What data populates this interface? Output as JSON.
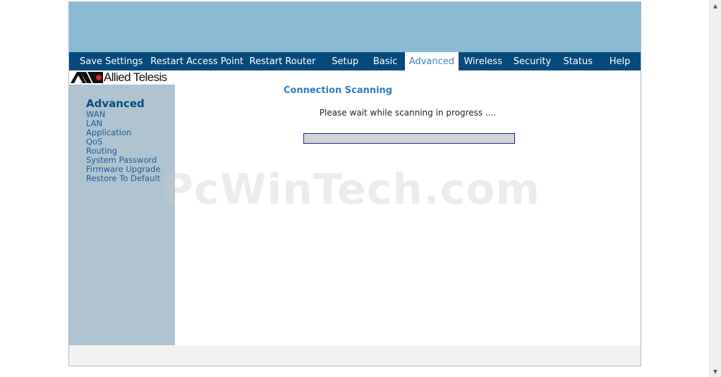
{
  "nav": {
    "items": [
      {
        "label": "Save Settings",
        "active": false
      },
      {
        "label": "Restart Access Point",
        "active": false
      },
      {
        "label": "Restart Router",
        "active": false
      },
      {
        "label": "Setup",
        "active": false
      },
      {
        "label": "Basic",
        "active": false
      },
      {
        "label": "Advanced",
        "active": true
      },
      {
        "label": "Wireless",
        "active": false
      },
      {
        "label": "Security",
        "active": false
      },
      {
        "label": "Status",
        "active": false
      },
      {
        "label": "Help",
        "active": false
      }
    ]
  },
  "logo": {
    "text": "Allied Telesis"
  },
  "sidebar": {
    "title": "Advanced",
    "items": [
      "WAN",
      "LAN",
      "Application",
      "QoS",
      "Routing",
      "System Password",
      "Firmware Upgrade",
      "Restore To Default"
    ]
  },
  "content": {
    "title": "Connection Scanning",
    "message": "Please wait while scanning in progress ....",
    "progress_percent": 0
  },
  "watermark": {
    "text": "PcWinTech.com"
  },
  "scrollbar": {
    "up_icon": "triangle-up-icon",
    "down_icon": "triangle-down-icon"
  },
  "colors": {
    "banner": "#8bbbd3",
    "navbar": "#064a7c",
    "active_tab_text": "#3a86c4",
    "sidebar_bg": "#afc3d1",
    "sidebar_title": "#0a4b7e",
    "sidebar_link": "#1f5d97",
    "content_title": "#2f7fc1",
    "progress_border": "#1a2c7a",
    "progress_track": "#d3d3d8"
  }
}
